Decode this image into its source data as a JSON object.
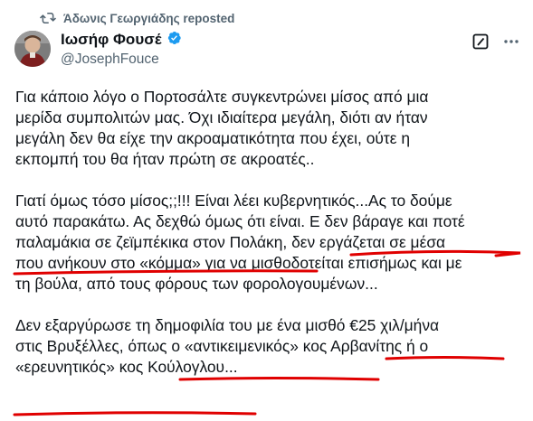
{
  "repost": {
    "text": "Άδωνις Γεωργιάδης reposted",
    "icon": "repost-icon"
  },
  "author": {
    "name": "Ιωσήφ Φουσέ",
    "handle": "@JosephFouce",
    "verified_icon": "verified-badge-icon",
    "verified_color": "#1d9bf0"
  },
  "actions": {
    "edit_icon": "grok-icon",
    "more_icon": "more-icon"
  },
  "tweet": {
    "paragraphs": [
      "Για κάποιο λόγο ο Πορτοσάλτε συγκεντρώνει μίσος από μια\nμερίδα συμπολιτών μας. Όχι ιδιαίτερα μεγάλη, διότι αν ήταν\nμεγάλη δεν θα είχε την ακροαματικότητα που έχει, ούτε η\nεκπομπή του θα ήταν πρώτη σε ακροατές..",
      "Γιατί όμως τόσο μίσος;;!!! Είναι λέει κυβερνητικός...Ας το δούμε\nαυτό παρακάτω. Ας δεχθώ όμως ότι είναι. Ε δεν βάραγε και ποτέ\nπαλαμάκια σε ζεϊμπέκικα στον Πολάκη, δεν εργάζεται σε μέσα\nπου ανήκουν στο «κόμμα» για να μισθοδοτείται επισήμως και με\nτη βούλα, από τους φόρους των φορολογουμένων...",
      "Δεν εξαργύρωσε τη δημοφιλία του με ένα μισθό €25 χιλ/μήνα\nστις Βρυξέλλες, όπως ο «αντικειμενικός» κος Αρβανίτης ή ο\n«ερευνητικός» κος Κούλογλου..."
    ]
  },
  "annotation_color": "#e00000"
}
